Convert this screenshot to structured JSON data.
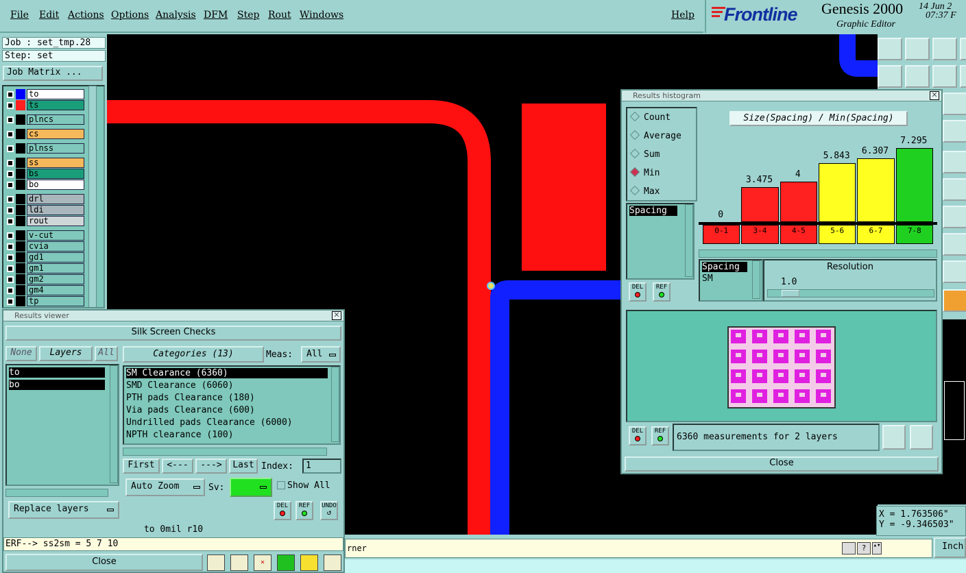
{
  "menu": {
    "items": [
      "File",
      "Edit",
      "Actions",
      "Options",
      "Analysis",
      "DFM",
      "Step",
      "Rout",
      "Windows"
    ],
    "help": "Help"
  },
  "brand": {
    "logo": "Frontline",
    "product": "Genesis 2000",
    "subtitle": "Graphic Editor",
    "date": "14 Jun 2",
    "time": "07:37 F"
  },
  "left": {
    "job": "Job : set_tmp.28",
    "step": "Step: set",
    "job_matrix": "Job Matrix ...",
    "layers": [
      {
        "name": "to",
        "color": "#ffffff",
        "swatch": "#0000ff"
      },
      {
        "name": "ts",
        "color": "#1a9e7a",
        "swatch": "#ff2020"
      },
      {
        "name": "plncs",
        "color": "#7fc8bb",
        "swatch": "#000000"
      },
      {
        "name": "cs",
        "color": "#f5b85a",
        "swatch": "#000000"
      },
      {
        "name": "plnss",
        "color": "#7fc8bb",
        "swatch": "#000000"
      },
      {
        "name": "ss",
        "color": "#f5b85a",
        "swatch": "#000000"
      },
      {
        "name": "bs",
        "color": "#1a9e7a",
        "swatch": "#000000"
      },
      {
        "name": "bo",
        "color": "#ffffff",
        "swatch": "#000000"
      },
      {
        "name": "drl",
        "color": "#a9b6bb",
        "swatch": "#000000"
      },
      {
        "name": "ldi",
        "color": "#a9b6bb",
        "swatch": "#000000"
      },
      {
        "name": "rout",
        "color": "#cfd6d8",
        "swatch": "#000000"
      },
      {
        "name": "v-cut",
        "color": "#7fc8bb",
        "swatch": "#000000"
      },
      {
        "name": "cvia",
        "color": "#7fc8bb",
        "swatch": "#000000"
      },
      {
        "name": "gd1",
        "color": "#7fc8bb",
        "swatch": "#000000"
      },
      {
        "name": "gm1",
        "color": "#7fc8bb",
        "swatch": "#000000"
      },
      {
        "name": "gm2",
        "color": "#7fc8bb",
        "swatch": "#000000"
      },
      {
        "name": "gm4",
        "color": "#7fc8bb",
        "swatch": "#000000"
      },
      {
        "name": "tp",
        "color": "#7fc8bb",
        "swatch": "#000000"
      }
    ]
  },
  "results_viewer": {
    "title": "Results viewer",
    "header": "Silk Screen Checks",
    "none_btn": "None",
    "layers_btn": "Layers",
    "all_btn": "All",
    "layer_list": [
      "to",
      "bo"
    ],
    "categories_btn": "Categories (13)",
    "meas_label": "Meas:",
    "meas_value": "All",
    "categories": [
      "SM Clearance (6360)",
      "SMD Clearance (6060)",
      "PTH pads Clearance (180)",
      "Via pads Clearance (600)",
      "Undrilled pads Clearance (6000)",
      "NPTH clearance (100)"
    ],
    "first": "First",
    "prev": "<---",
    "next": "--->",
    "last": "Last",
    "index_label": "Index:",
    "index_value": "1",
    "auto_zoom": "Auto Zoom",
    "sv_label": "Sv:",
    "show_all": "Show All",
    "replace_layers": "Replace layers",
    "status": "to 0mil  r10",
    "erf": "ERF--> ss2sm = 5 7 10",
    "close": "Close",
    "del": "DEL",
    "ref": "REF",
    "undo": "UNDO"
  },
  "histogram": {
    "title": "Results histogram",
    "radios": [
      "Count",
      "Average",
      "Sum",
      "Min",
      "Max"
    ],
    "selected_radio": "Min",
    "chart_title": "Size(Spacing) / Min(Spacing)",
    "list1": [
      "Spacing"
    ],
    "list2": [
      "Spacing",
      "SM"
    ],
    "resolution_label": "Resolution",
    "resolution_value": "1.0",
    "info": "6360 measurements for 2 layers",
    "close": "Close",
    "del": "DEL",
    "ref": "REF"
  },
  "chart_data": {
    "type": "bar",
    "title": "Size(Spacing) / Min(Spacing)",
    "categories": [
      "0-1",
      "3-4",
      "4-5",
      "5-6",
      "6-7",
      "7-8"
    ],
    "values": [
      0,
      3.475,
      4,
      5.843,
      6.307,
      7.295
    ],
    "value_labels": [
      "0",
      "3.475",
      "4",
      "5.843",
      "6.307",
      "7.295"
    ],
    "colors": [
      "#ff2020",
      "#ff2020",
      "#ff2020",
      "#ffff20",
      "#ffff20",
      "#20d020"
    ],
    "ylim": [
      0,
      8
    ]
  },
  "bottom": {
    "message": "rner",
    "units": "Inch"
  },
  "coords": {
    "x": "X = 1.763506\"",
    "y": "Y = -9.346503\""
  }
}
